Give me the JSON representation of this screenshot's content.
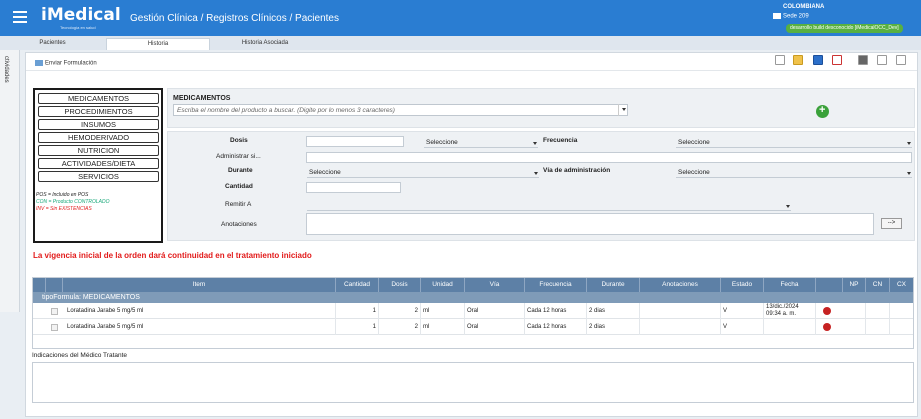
{
  "header": {
    "logo_text": "iMedical",
    "logo_tagline": "Tecnología en salud",
    "breadcrumb": "Gestión Clínica / Registros Clínicos / Pacientes",
    "country": "COLOMBIANA",
    "sede": "Sede 209",
    "env_badge": "desarrollo build desconocido [iMedicalOCC_Dev]"
  },
  "tabs": [
    {
      "label": "Pacientes"
    },
    {
      "label": "Historia",
      "active": true
    },
    {
      "label": "Historia Asociada"
    }
  ],
  "side_tab": {
    "label": "ctividades"
  },
  "toolbar": {
    "enviar_label": "Enviar Formulación"
  },
  "categories": [
    "MEDICAMENTOS",
    "PROCEDIMIENTOS",
    "INSUMOS",
    "HEMODERIVADO",
    "NUTRICION",
    "ACTIVIDADES/DIETA",
    "SERVICIOS"
  ],
  "legend": [
    {
      "text": "POS = Incluido en POS",
      "color": "#222222"
    },
    {
      "text": "CON = Producto CONTROLADO",
      "color": "#1aa87a"
    },
    {
      "text": "INV = Sin EXISTENCIAS",
      "color": "#e21a1a"
    }
  ],
  "medicamentos": {
    "title": "MEDICAMENTOS",
    "search_placeholder": "Escriba el nombre del producto a buscar. (Digite por lo menos 3 caracteres)"
  },
  "form": {
    "dosis_label": "Dosis",
    "dosis_unit_value": "Seleccione",
    "frecuencia_label": "Frecuencia",
    "frecuencia_value": "Seleccione",
    "administrar_label": "Administrar si...",
    "durante_label": "Durante",
    "durante_value": "Seleccione",
    "via_label": "Vía de administración",
    "via_value": "Seleccione",
    "cantidad_label": "Cantidad",
    "remitir_label": "Remitir A",
    "anotaciones_label": "Anotaciones",
    "arrow_button": "-->"
  },
  "warning": "La vigencia inicial de la orden dará continuidad en el tratamiento iniciado",
  "table": {
    "headers": [
      "Item",
      "Cantidad",
      "Dosis",
      "Unidad",
      "Vía",
      "Frecuencia",
      "Durante",
      "Anotaciones",
      "Estado",
      "Fecha",
      "NP",
      "CN",
      "CX"
    ],
    "group_label": "tipoFormula: MEDICAMENTOS",
    "rows": [
      {
        "item": "Loratadina Jarabe 5 mg/5 ml",
        "cantidad": "1",
        "dosis": "2",
        "unidad": "ml",
        "via": "Oral",
        "frecuencia": "Cada 12 horas",
        "durante": "2 dias",
        "anotaciones": "",
        "estado": "V",
        "fecha_line1": "13/dic./2024",
        "fecha_line2": "09:34 a. m."
      },
      {
        "item": "Loratadina Jarabe 5 mg/5 ml",
        "cantidad": "1",
        "dosis": "2",
        "unidad": "ml",
        "via": "Oral",
        "frecuencia": "Cada 12 horas",
        "durante": "2 dias",
        "anotaciones": "",
        "estado": "V",
        "fecha_line1": "",
        "fecha_line2": ""
      }
    ]
  },
  "indicaciones": {
    "label": "Indicaciones del Médico Tratante"
  },
  "colors": {
    "topbar": "#2a7dd2",
    "warning": "#e21a1a",
    "table_header": "#5d80a6",
    "env_badge": "#58b041"
  }
}
